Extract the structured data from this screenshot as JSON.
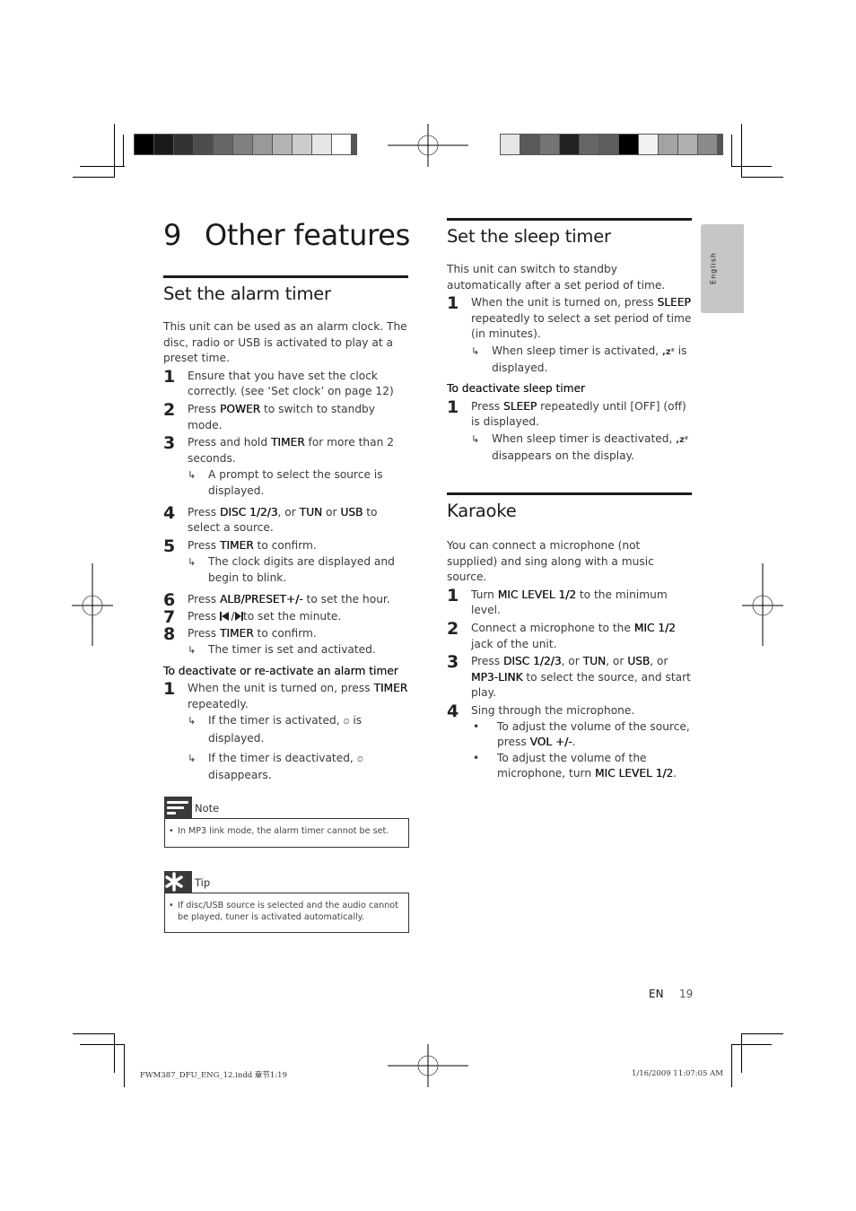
{
  "print_marks": {
    "color_bar_left": [
      "#000000",
      "#1a1a1a",
      "#333333",
      "#4d4d4d",
      "#666666",
      "#808080",
      "#999999",
      "#b3b3b3",
      "#cccccc",
      "#e6e6e6",
      "#ffffff"
    ],
    "color_bar_right": [
      "#e6e6e6",
      "#5a5a5a",
      "#747474",
      "#222222",
      "#666666",
      "#5e5e5e",
      "#000000",
      "#f2f2f2",
      "#a3a3a3",
      "#b0b0b0",
      "#8a8a8a"
    ]
  },
  "chapter": {
    "number": "9",
    "title": "Other features"
  },
  "alarm": {
    "title": "Set the alarm timer",
    "intro": "This unit can be used as an alarm clock. The disc, radio or USB is activated to play at a preset time.",
    "steps": [
      {
        "n": "1",
        "parts": [
          "Ensure that you have set the clock correctly. (see ‘Set clock’ on page 12)"
        ]
      },
      {
        "n": "2",
        "pre": "Press ",
        "bold": "POWER",
        "post": " to switch to standby mode."
      },
      {
        "n": "3",
        "pre": "Press and hold ",
        "bold": "TIMER",
        "post": " for more than 2 seconds.",
        "result": "A prompt to select the source is displayed."
      },
      {
        "n": "4",
        "pre": "Press ",
        "bold": "DISC 1/2/3",
        "mid1": ", or ",
        "bold2": "TUN",
        "mid2": " or ",
        "bold3": "USB",
        "post": " to select a source."
      },
      {
        "n": "5",
        "pre": "Press ",
        "bold": "TIMER",
        "post": " to confirm.",
        "result": "The clock digits are displayed and begin to blink."
      },
      {
        "n": "6",
        "pre": "Press ",
        "bold": "ALB/PRESET+/-",
        "post": " to set the hour."
      },
      {
        "n": "7",
        "pre": "Press ",
        "icon": "prev-next-icon",
        "post": "to set the minute."
      },
      {
        "n": "8",
        "pre": "Press ",
        "bold": "TIMER",
        "post": " to confirm.",
        "result": "The timer is set and activated."
      }
    ],
    "deactivate_heading": "To deactivate or re-activate an alarm timer",
    "deactivate_step": {
      "n": "1",
      "pre": "When the unit is turned on, press ",
      "bold": "TIMER",
      "post": " repeatedly."
    },
    "deactivate_results": [
      {
        "pre": "If the timer is activated, ",
        "icon": "alarm-clock-icon",
        "post": " is displayed."
      },
      {
        "pre": "If the timer is deactivated, ",
        "icon": "alarm-clock-icon",
        "post": " disappears."
      }
    ],
    "note": {
      "label": "Note",
      "text": "In MP3 link mode, the alarm timer cannot be set."
    },
    "tip": {
      "label": "Tip",
      "text": "If disc/USB source is selected and the audio cannot be played, tuner is activated automatically."
    }
  },
  "sleep": {
    "title": "Set the sleep timer",
    "intro": "This unit can switch to standby automatically after a set period of time.",
    "step1": {
      "n": "1",
      "pre": "When the unit is turned on, press ",
      "bold": "SLEEP",
      "post": " repeatedly to select a set period of time (in minutes)."
    },
    "step1_result": {
      "pre": "When sleep timer is activated, ",
      "icon": "sleep-zz-icon",
      "post": " is displayed."
    },
    "deactivate_heading": "To deactivate sleep timer",
    "deactivate_step": {
      "n": "1",
      "pre": "Press ",
      "bold": "SLEEP",
      "post": " repeatedly until [OFF] (off) is displayed."
    },
    "deactivate_result": {
      "pre": "When sleep timer is deactivated, ",
      "icon": "sleep-zz-icon",
      "post": " disappears on the display."
    },
    "zz_glyph": ",zᶻ"
  },
  "karaoke": {
    "title": "Karaoke",
    "intro": "You can connect a microphone (not supplied) and sing along with a music source.",
    "step1": {
      "n": "1",
      "pre": "Turn ",
      "bold": "MIC LEVEL 1/2",
      "post": " to the minimum level."
    },
    "step2": {
      "n": "2",
      "pre": "Connect a microphone to the ",
      "bold": "MIC 1/2",
      "post": " jack of the unit."
    },
    "step3": {
      "n": "3",
      "pre": "Press ",
      "b1": "DISC 1/2/3",
      "m1": ", or ",
      "b2": "TUN",
      "m2": ", or ",
      "b3": "USB",
      "m3": ", or ",
      "b4": "MP3-LINK",
      "post": " to select the source, and start play."
    },
    "step4": {
      "n": "4",
      "text": "Sing through the microphone."
    },
    "bullets": [
      {
        "pre": "To adjust the volume of the source, press ",
        "bold": "VOL +/-",
        "post": "."
      },
      {
        "pre": "To adjust the volume of the microphone, turn ",
        "bold": "MIC LEVEL 1/2",
        "post": "."
      }
    ]
  },
  "side_tab": {
    "label": "English"
  },
  "footer": {
    "lang": "EN",
    "page": "19"
  },
  "slug": {
    "file": "FWM387_DFU_ENG_12.indd   章节1:19",
    "date": "1/16/2009    11:07:05 AM"
  },
  "glyphs": {
    "arrow": "↳",
    "bullet": "•",
    "note_bullet": "•"
  }
}
